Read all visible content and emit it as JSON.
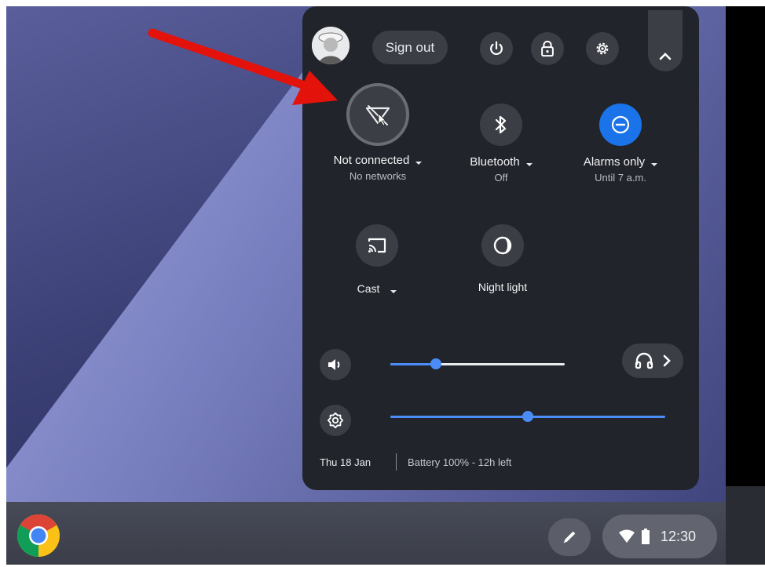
{
  "top_bar": {
    "sign_out_label": "Sign out",
    "icons": [
      "power-icon",
      "lock-icon",
      "gear-icon",
      "chevron-up-icon"
    ]
  },
  "tiles": [
    {
      "label": "Not connected",
      "sublabel": "No networks",
      "icon": "wifi-off-icon",
      "has_dropdown": true
    },
    {
      "label": "Bluetooth",
      "sublabel": "Off",
      "icon": "bluetooth-icon",
      "has_dropdown": true
    },
    {
      "label": "Alarms only",
      "sublabel": "Until 7 a.m.",
      "icon": "do-not-disturb-icon",
      "has_dropdown": true,
      "active": true
    },
    {
      "label": "Cast",
      "icon": "cast-icon",
      "has_dropdown": true
    },
    {
      "label": "Night light",
      "icon": "night-light-icon",
      "has_dropdown": false
    }
  ],
  "sliders": {
    "volume": {
      "level": 0.26
    },
    "brightness": {
      "level": 0.5
    }
  },
  "footer": {
    "date": "Thu 18 Jan",
    "battery": "Battery 100% - 12h left"
  },
  "shelf": {
    "time": "12:30"
  },
  "colors": {
    "panel_bg": "#22242b",
    "button_bg": "#3c3e46",
    "accent_blue": "#1a73e8",
    "slider_blue": "#4a8df8",
    "arrow_red": "#e3120b"
  }
}
